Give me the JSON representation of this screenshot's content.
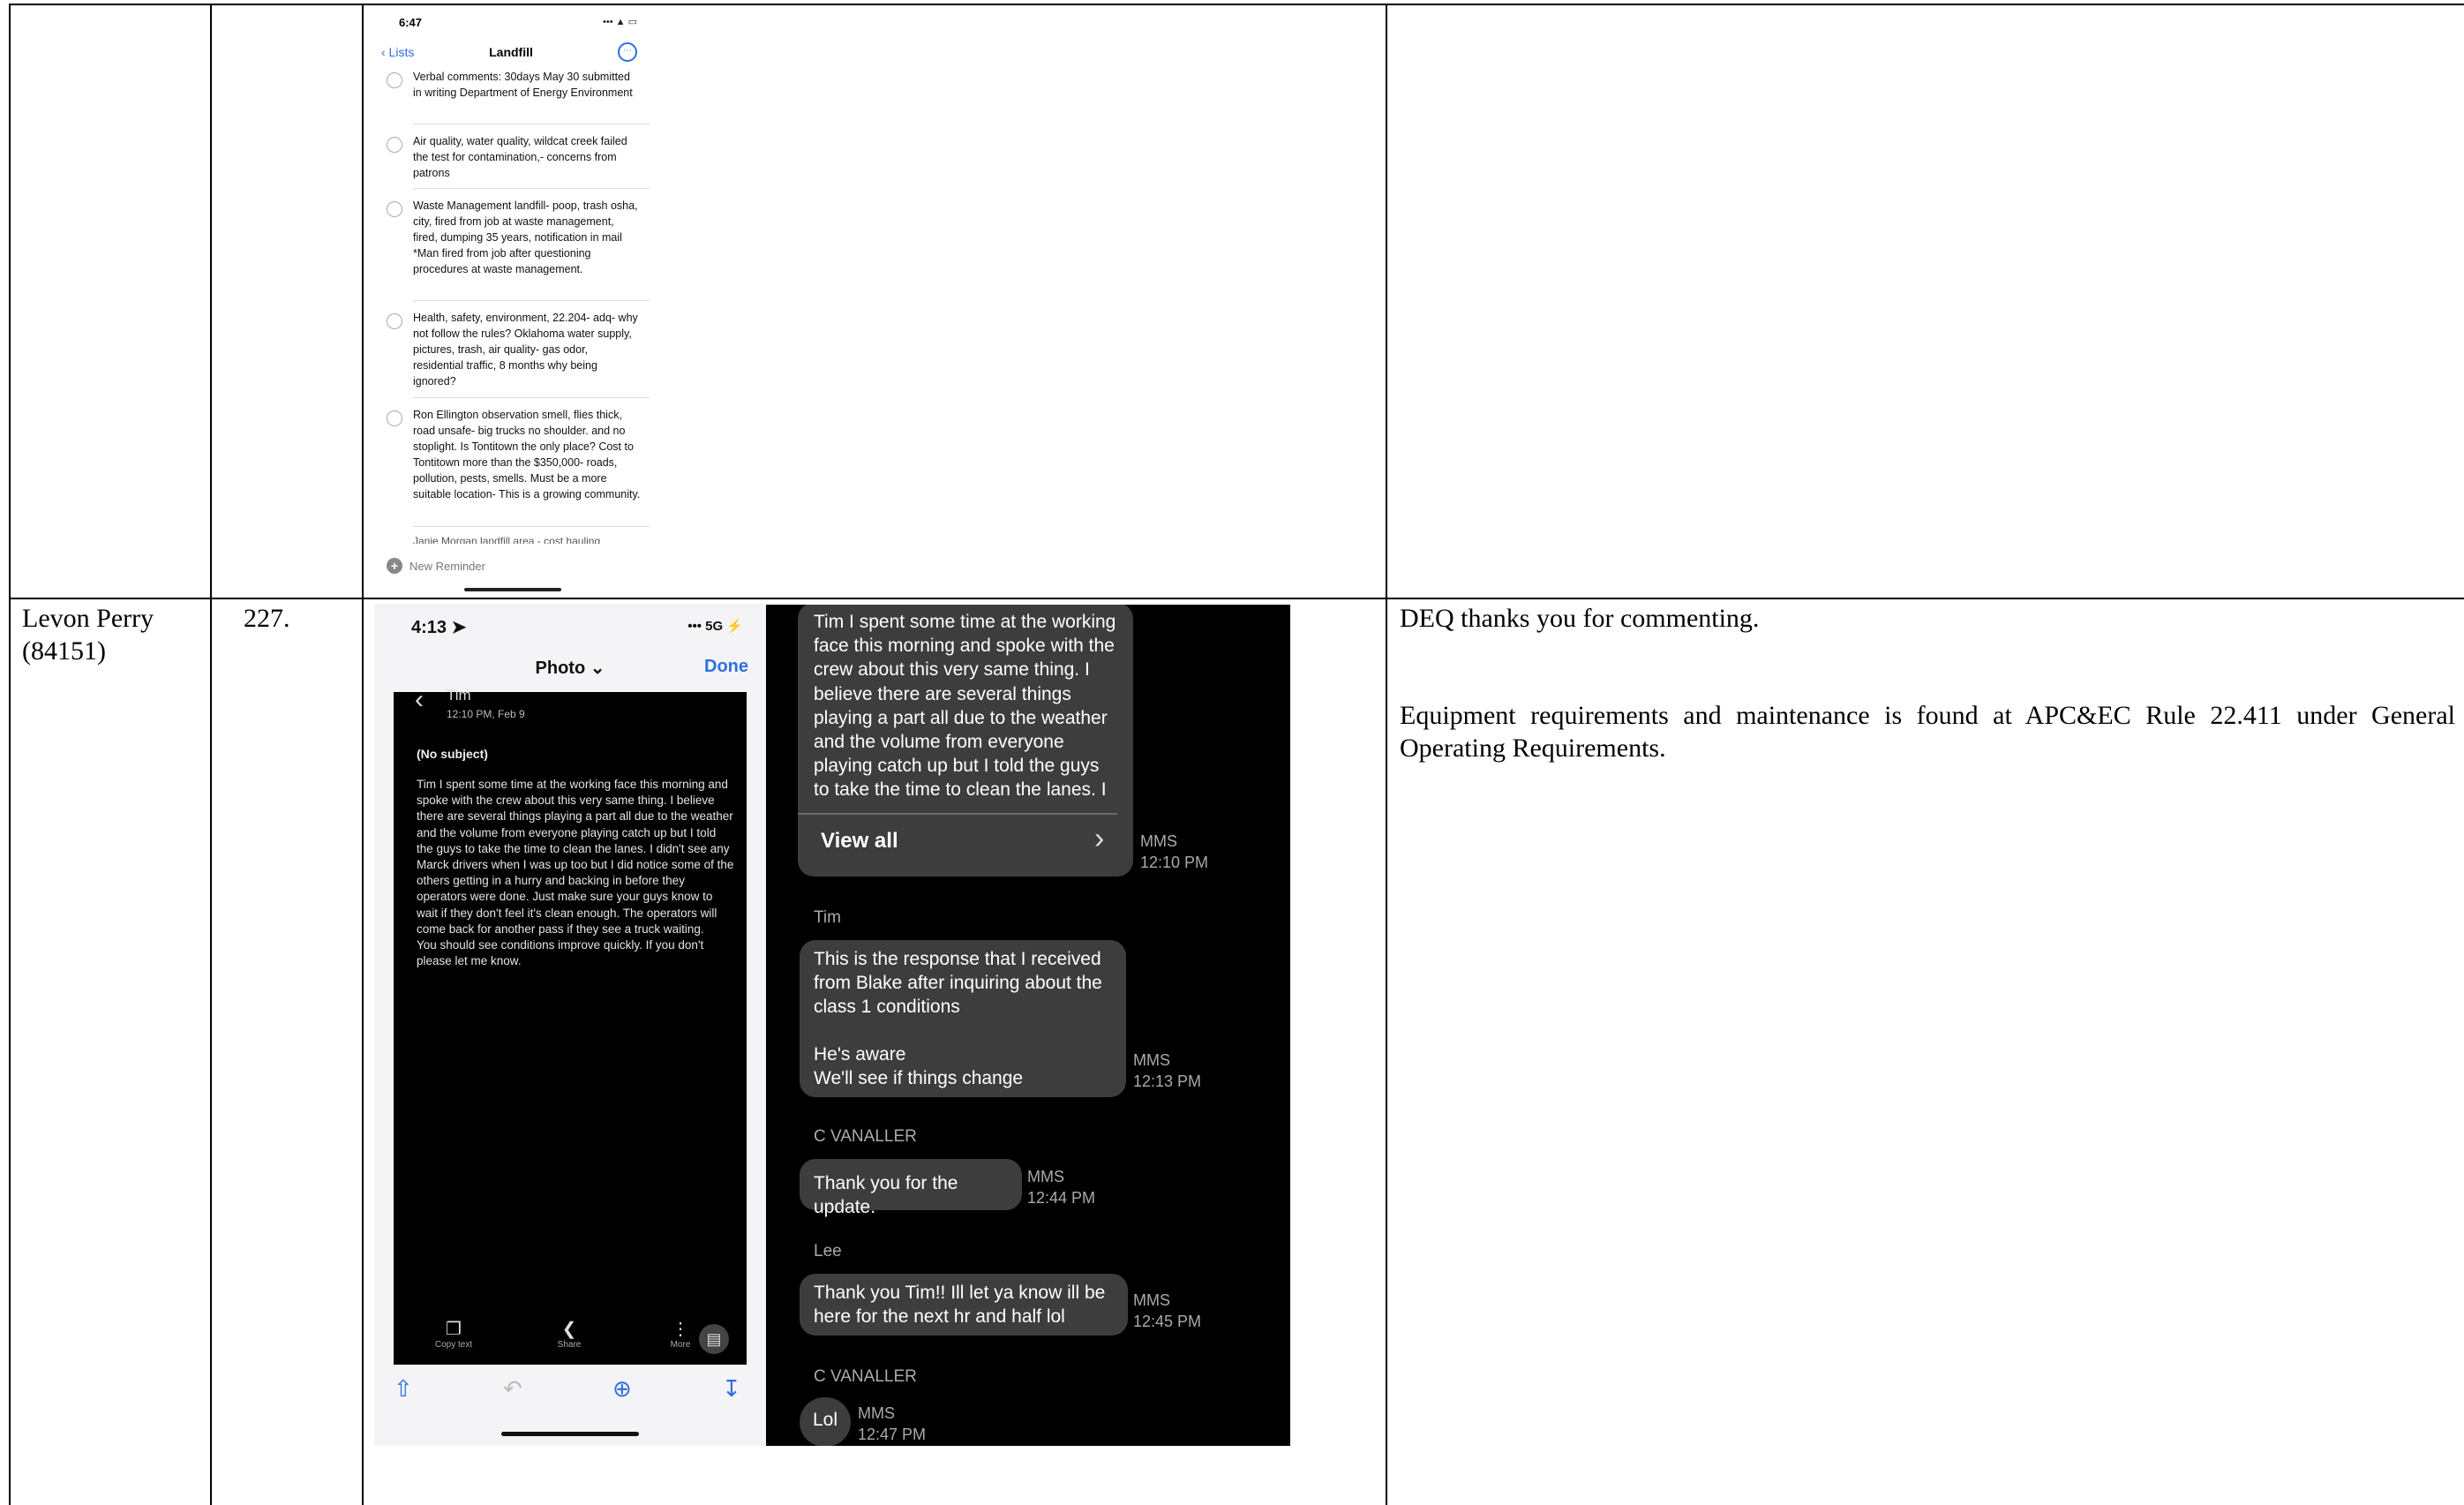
{
  "table": {
    "row2": {
      "commenter": "Levon Perry (84151)",
      "number": "227.",
      "response_lines": [
        "DEQ thanks you for commenting.",
        "Equipment requirements and maintenance is found at APC&EC Rule 22.411 under General Operating Requirements."
      ]
    }
  },
  "reminders_screenshot": {
    "status_time": "6:47",
    "status_icons": "••• ▲ ▭",
    "back_label": "‹ Lists",
    "title": "Landfill",
    "more_icon": "⋯",
    "items": [
      "Verbal comments:  30days May 30 submitted in writing Department of Energy Environment",
      "Air quality, water quality, wildcat creek failed the test for contamination,- concerns from patrons",
      "Waste Management landfill- poop, trash osha, city, fired from job at waste management, fired, dumping 35 years, notification in mail *Man fired from job after questioning procedures at waste management.",
      "Health, safety, environment, 22.204- adq- why not follow the rules? Oklahoma water supply, pictures, trash, air quality- gas odor, residential traffic, 8 months why being ignored?",
      "Ron Ellington observation smell, flies thick, road unsafe- big trucks no shoulder. and no stoplight.   Is Tontitown the only place?  Cost to Tontitown more than the $350,000- roads, pollution, pests, smells.  Must be a more suitable location- This is a growing community."
    ],
    "cut_item": "Janie Morgan landfill area - cost hauling",
    "new_reminder": "New Reminder"
  },
  "photo_screenshot": {
    "status_time": "4:13 ➤",
    "status_icons": "••• 5G ⚡",
    "title": "Photo ⌄",
    "done": "Done",
    "sender": "Tim",
    "time": "12:10 PM, Feb 9",
    "subject": "(No subject)",
    "body": "Tim I spent some time at the working face this morning and spoke with the crew about this very same thing. I believe there are several things playing a part all due to the weather and the volume from everyone playing catch up but I told the guys to take the time to clean the lanes. I didn't see any Marck drivers when I was up too but I did notice some of the others getting in a hurry and backing in before they operators were done. Just make sure your guys know to wait if they don't feel it's clean enough. The operators will come back for another pass if they see a truck waiting.\nYou should see conditions improve quickly. If you don't please let me know.",
    "actions": [
      "Copy text",
      "Share",
      "More"
    ]
  },
  "messages_screenshot": {
    "bubble1": "Tim I spent some time at the working face this morning and spoke with the crew about this very same thing. I believe there are several things playing a part all due to the weather and the volume from everyone playing catch up but I told the guys to take the time to clean the lanes. I didn't see any",
    "view_all": "View all",
    "meta1": "MMS\n12:10 PM",
    "sender2": "Tim",
    "bubble2": "This is the response that I received from Blake after inquiring about the class 1 conditions\n\nHe's aware\nWe'll see if things change",
    "meta2": "MMS\n12:13 PM",
    "sender3": "C VANALLER",
    "bubble3": "Thank you for the update.",
    "meta3": "MMS\n12:44 PM",
    "sender4": "Lee",
    "bubble4": "Thank you Tim!! Ill let ya know ill be here for the next hr and half lol",
    "meta4": "MMS\n12:45 PM",
    "sender5": "C VANALLER",
    "bubble5": "Lol",
    "meta5": "MMS\n12:47 PM"
  }
}
